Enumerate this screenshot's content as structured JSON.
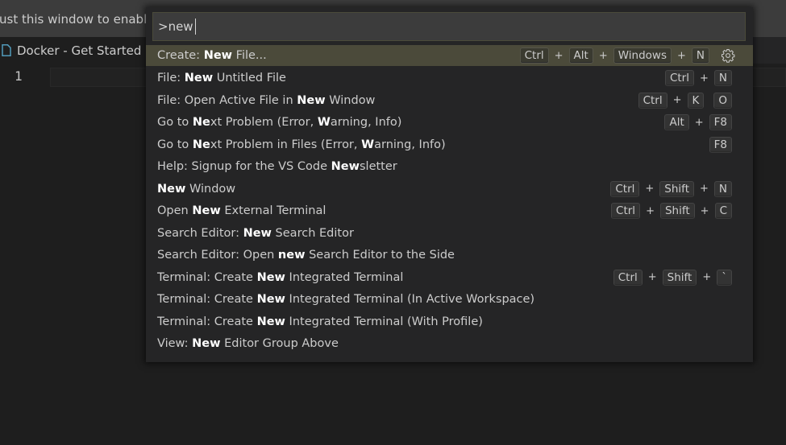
{
  "trust_bar": {
    "text": "ust this window to enable al"
  },
  "tab": {
    "label": "Docker - Get Started"
  },
  "editor": {
    "line_number": "1"
  },
  "quick_pick": {
    "input_value": ">new",
    "items": [
      {
        "parts": [
          [
            "Create: ",
            false
          ],
          [
            "New",
            true
          ],
          [
            " File...",
            false
          ]
        ],
        "keys": [
          [
            "Ctrl",
            "Alt",
            "Windows",
            "N"
          ]
        ],
        "active": true,
        "gear": "gear-icon"
      },
      {
        "parts": [
          [
            "File: ",
            false
          ],
          [
            "New",
            true
          ],
          [
            " Untitled File",
            false
          ]
        ],
        "keys": [
          [
            "Ctrl",
            "N"
          ]
        ]
      },
      {
        "parts": [
          [
            "File: Open Active File in ",
            false
          ],
          [
            "New",
            true
          ],
          [
            " Window",
            false
          ]
        ],
        "keys": [
          [
            "Ctrl",
            "K"
          ],
          [
            "O"
          ]
        ]
      },
      {
        "parts": [
          [
            "Go to ",
            false
          ],
          [
            "Ne",
            true
          ],
          [
            "xt Problem (Error, ",
            false
          ],
          [
            "W",
            true
          ],
          [
            "arning, Info)",
            false
          ]
        ],
        "keys": [
          [
            "Alt",
            "F8"
          ]
        ]
      },
      {
        "parts": [
          [
            "Go to ",
            false
          ],
          [
            "Ne",
            true
          ],
          [
            "xt Problem in Files (Error, ",
            false
          ],
          [
            "W",
            true
          ],
          [
            "arning, Info)",
            false
          ]
        ],
        "keys": [
          [
            "F8"
          ]
        ]
      },
      {
        "parts": [
          [
            "Help: Signup for the VS Code ",
            false
          ],
          [
            "New",
            true
          ],
          [
            "sletter",
            false
          ]
        ],
        "keys": []
      },
      {
        "parts": [
          [
            "New",
            true
          ],
          [
            " Window",
            false
          ]
        ],
        "keys": [
          [
            "Ctrl",
            "Shift",
            "N"
          ]
        ]
      },
      {
        "parts": [
          [
            "Open ",
            false
          ],
          [
            "New",
            true
          ],
          [
            " External Terminal",
            false
          ]
        ],
        "keys": [
          [
            "Ctrl",
            "Shift",
            "C"
          ]
        ]
      },
      {
        "parts": [
          [
            "Search Editor: ",
            false
          ],
          [
            "New",
            true
          ],
          [
            " Search Editor",
            false
          ]
        ],
        "keys": []
      },
      {
        "parts": [
          [
            "Search Editor: Open ",
            false
          ],
          [
            "new",
            true
          ],
          [
            " Search Editor to the Side",
            false
          ]
        ],
        "keys": []
      },
      {
        "parts": [
          [
            "Terminal: Create ",
            false
          ],
          [
            "New",
            true
          ],
          [
            " Integrated Terminal",
            false
          ]
        ],
        "keys": [
          [
            "Ctrl",
            "Shift",
            "`"
          ]
        ]
      },
      {
        "parts": [
          [
            "Terminal: Create ",
            false
          ],
          [
            "New",
            true
          ],
          [
            " Integrated Terminal (In Active Workspace)",
            false
          ]
        ],
        "keys": []
      },
      {
        "parts": [
          [
            "Terminal: Create ",
            false
          ],
          [
            "New",
            true
          ],
          [
            " Integrated Terminal (With Profile)",
            false
          ]
        ],
        "keys": []
      },
      {
        "parts": [
          [
            "View: ",
            false
          ],
          [
            "New",
            true
          ],
          [
            " Editor Group Above",
            false
          ]
        ],
        "keys": []
      }
    ]
  },
  "colors": {
    "background": "#1e1e1e",
    "widget": "#252526",
    "active_row": "#4b4a3a",
    "highlight_text": "#ffffff"
  }
}
